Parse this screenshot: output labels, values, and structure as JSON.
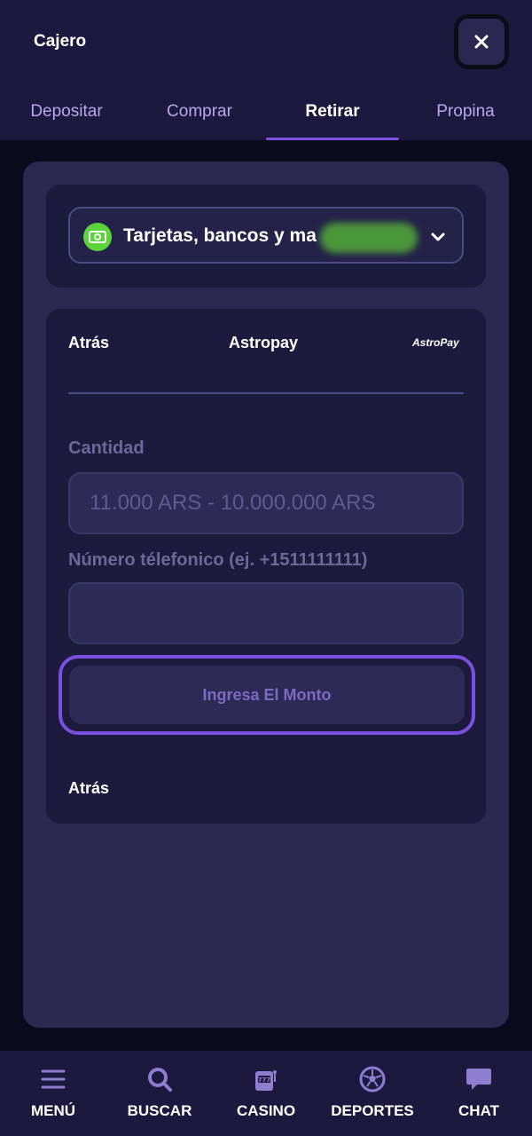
{
  "header": {
    "title": "Cajero",
    "close_icon": "close-icon"
  },
  "tabs": [
    {
      "label": "Depositar",
      "active": false
    },
    {
      "label": "Comprar",
      "active": false
    },
    {
      "label": "Retirar",
      "active": true
    },
    {
      "label": "Propina",
      "active": false
    }
  ],
  "method": {
    "label": "Tarjetas, bancos y ma",
    "icon": "cash-icon",
    "icon_color": "#5ad43a",
    "dropdown_icon": "chevron-down-icon"
  },
  "form": {
    "back_label": "Atrás",
    "provider_title": "Astropay",
    "provider_logo_text": "AstroPay",
    "amount_label": "Cantidad",
    "amount_placeholder": "11.000 ARS - 10.000.000 ARS",
    "amount_value": "",
    "phone_label": "Número télefonico (ej. +1511111111)",
    "phone_value": "",
    "submit_label": "Ingresa El Monto",
    "back_bottom_label": "Atrás"
  },
  "bottom_nav": [
    {
      "label": "MENÚ",
      "icon": "menu-icon"
    },
    {
      "label": "BUSCAR",
      "icon": "search-icon"
    },
    {
      "label": "CASINO",
      "icon": "slot-machine-icon"
    },
    {
      "label": "DEPORTES",
      "icon": "soccer-ball-icon"
    },
    {
      "label": "CHAT",
      "icon": "chat-bubble-icon"
    }
  ],
  "colors": {
    "accent": "#7b4fe0",
    "background": "#1b1a3e",
    "panel": "#2d2850"
  }
}
